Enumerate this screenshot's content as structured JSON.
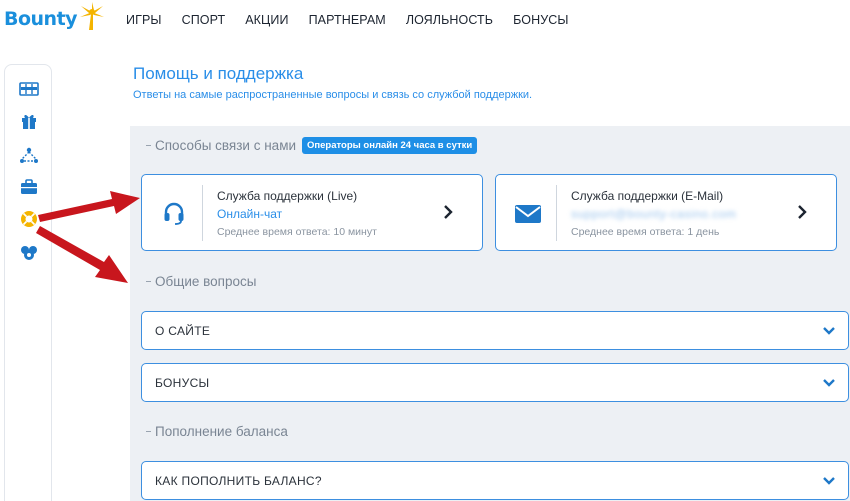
{
  "brand": {
    "name": "Bounty",
    "accent": "#1a8fdc",
    "star_color": "#f4b400"
  },
  "nav": {
    "items": [
      "ИГРЫ",
      "СПОРТ",
      "АКЦИИ",
      "ПАРТНЕРАМ",
      "ЛОЯЛЬНОСТЬ",
      "БОНУСЫ"
    ]
  },
  "sidebar": {
    "icons": [
      "slots-icon",
      "gift-icon",
      "tournament-icon",
      "briefcase-icon",
      "lifebuoy-icon",
      "support-group-icon"
    ],
    "active": "lifebuoy-icon"
  },
  "page": {
    "title": "Помощь и поддержка",
    "subtitle": "Ответы на самые распространенные вопросы и связь со службой поддержки."
  },
  "contact_section": {
    "heading": "Способы связи с нами",
    "badge": "Операторы онлайн 24 часа в сутки"
  },
  "cards": [
    {
      "icon": "headset-icon",
      "title": "Служба поддержки (Live)",
      "subtitle": "Онлайн-чат",
      "note": "Среднее время ответа: 10 минут"
    },
    {
      "icon": "mail-icon",
      "title": "Служба поддержки (E-Mail)",
      "subtitle": "support@bounty-casino.com",
      "note": "Среднее время ответа: 1 день"
    }
  ],
  "general_section": {
    "heading": "Общие вопросы"
  },
  "general_items": [
    "О САЙТЕ",
    "БОНУСЫ"
  ],
  "deposit_section": {
    "heading": "Пополнение баланса"
  },
  "deposit_items": [
    "КАК ПОПОЛНИТЬ БАЛАНС?"
  ],
  "colors": {
    "primary": "#2a8ee8",
    "border": "#3d8fe0",
    "panel": "#edf0f4",
    "arrow": "#c8161d"
  }
}
